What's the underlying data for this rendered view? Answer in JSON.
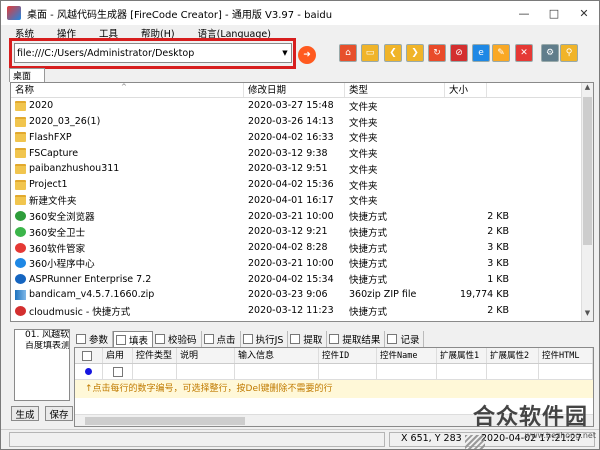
{
  "window": {
    "title": "桌面 - 风越代码生成器 [FireCode Creator] - 通用版 V3.97 - baidu",
    "controls": {
      "minimize": "—",
      "maximize": "□",
      "close": "✕"
    }
  },
  "menu": [
    "系统",
    "操作",
    "工具",
    "帮助(H)",
    "语言(Language)"
  ],
  "toolbar": {
    "address": "file:///C:/Users/Administrator/Desktop",
    "icons": [
      {
        "name": "home-icon",
        "color": "#e7502c",
        "glyph": "⌂"
      },
      {
        "name": "folder-icon",
        "color": "#f0b429",
        "glyph": "▭"
      },
      {
        "name": "back-icon",
        "color": "#f0b429",
        "glyph": "❮"
      },
      {
        "name": "forward-icon",
        "color": "#f0b429",
        "glyph": "❯"
      },
      {
        "name": "refresh-icon",
        "color": "#e94b2a",
        "glyph": "↻"
      },
      {
        "name": "stop-icon",
        "color": "#d32f2f",
        "glyph": "⊘"
      },
      {
        "name": "ie-icon",
        "color": "#1e88e5",
        "glyph": "e"
      },
      {
        "name": "pen-icon",
        "color": "#f9a825",
        "glyph": "✎"
      },
      {
        "name": "delete-icon",
        "color": "#e53935",
        "glyph": "✕"
      },
      {
        "name": "settings-icon",
        "color": "#607d8b",
        "glyph": "⚙"
      },
      {
        "name": "search-icon",
        "color": "#f0b429",
        "glyph": "⚲"
      }
    ]
  },
  "top_tab": "桌面",
  "file_list": {
    "columns": [
      "名称",
      "修改日期",
      "类型",
      "大小"
    ],
    "sort_glyph": "^",
    "rows": [
      {
        "name": "2020",
        "date": "2020-03-27 15:48",
        "type": "文件夹",
        "size": "",
        "icon": "folder"
      },
      {
        "name": "2020_03_26(1)",
        "date": "2020-03-26 14:13",
        "type": "文件夹",
        "size": "",
        "icon": "folder"
      },
      {
        "name": "FlashFXP",
        "date": "2020-04-02 16:33",
        "type": "文件夹",
        "size": "",
        "icon": "folder"
      },
      {
        "name": "FSCapture",
        "date": "2020-03-12 9:38",
        "type": "文件夹",
        "size": "",
        "icon": "folder"
      },
      {
        "name": "paibanzhushou311",
        "date": "2020-03-12 9:51",
        "type": "文件夹",
        "size": "",
        "icon": "folder"
      },
      {
        "name": "Project1",
        "date": "2020-04-02 15:36",
        "type": "文件夹",
        "size": "",
        "icon": "folder"
      },
      {
        "name": "新建文件夹",
        "date": "2020-04-01 16:17",
        "type": "文件夹",
        "size": "",
        "icon": "folder"
      },
      {
        "name": "360安全浏览器",
        "date": "2020-03-21 10:00",
        "type": "快捷方式",
        "size": "2 KB",
        "icon": "shortcut",
        "color": "#2e9d3b"
      },
      {
        "name": "360安全卫士",
        "date": "2020-03-12 9:21",
        "type": "快捷方式",
        "size": "2 KB",
        "icon": "shortcut",
        "color": "#3bb54a"
      },
      {
        "name": "360软件管家",
        "date": "2020-04-02 8:28",
        "type": "快捷方式",
        "size": "3 KB",
        "icon": "shortcut",
        "color": "#e53935"
      },
      {
        "name": "360小程序中心",
        "date": "2020-03-21 10:00",
        "type": "快捷方式",
        "size": "3 KB",
        "icon": "shortcut",
        "color": "#1e88e5"
      },
      {
        "name": "ASPRunner Enterprise 7.2",
        "date": "2020-04-02 15:34",
        "type": "快捷方式",
        "size": "1 KB",
        "icon": "shortcut",
        "color": "#1565c0"
      },
      {
        "name": "bandicam_v4.5.7.1660.zip",
        "date": "2020-03-23 9:06",
        "type": "360zip ZIP file",
        "size": "19,774 KB",
        "icon": "zip"
      },
      {
        "name": "cloudmusic - 快捷方式",
        "date": "2020-03-12 11:23",
        "type": "快捷方式",
        "size": "2 KB",
        "icon": "shortcut",
        "color": "#d32f2f"
      }
    ]
  },
  "tree": [
    "01. 风越软",
    "百度填表测"
  ],
  "buttons": {
    "generate": "生成",
    "save": "保存"
  },
  "bottom_tabs": [
    {
      "label": "参数",
      "active": false
    },
    {
      "label": "填表",
      "active": true
    },
    {
      "label": "校验码",
      "active": false
    },
    {
      "label": "点击",
      "active": false
    },
    {
      "label": "执行JS",
      "active": false
    },
    {
      "label": "提取",
      "active": false
    },
    {
      "label": "提取结果",
      "active": false
    },
    {
      "label": "记录",
      "active": false
    }
  ],
  "grid": {
    "columns": [
      "",
      "启用",
      "控件类型",
      "说明",
      "输入信息",
      "控件ID",
      "控件Name",
      "扩展属性1",
      "扩展属性2",
      "控件HTML"
    ],
    "hint": "↑点击每行的数字编号，可选择整行，按Del键删除不需要的行"
  },
  "status": {
    "coords": "X 651, Y 283",
    "datetime": "2020-04-02 17:21:27"
  },
  "watermark": {
    "text": "合众软件园",
    "url": "www.hezhong.net"
  }
}
